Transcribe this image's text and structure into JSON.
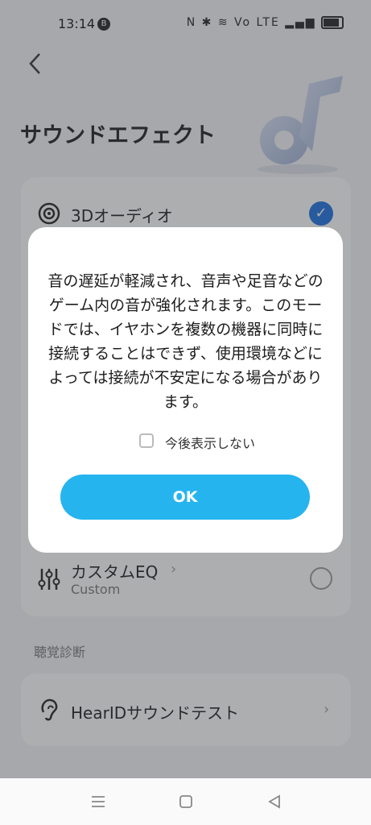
{
  "status_bar": {
    "time": "13:14",
    "badge": "B",
    "icons": "N ✱ ≋ Vo LTE ▂▄▆"
  },
  "header": {
    "back_icon": "chevron-left-icon",
    "title": "サウンドエフェクト"
  },
  "effects": {
    "item_3d": {
      "label": "3Dオーディオ",
      "selected": true
    },
    "item_custom": {
      "label": "カスタムEQ",
      "sublabel": "Custom",
      "selected": false
    }
  },
  "hearing": {
    "section_label": "聴覚診断",
    "test_label": "HearIDサウンドテスト"
  },
  "dialog": {
    "message": "音の遅延が軽減され、音声や足音などのゲーム内の音が強化されます。このモードでは、イヤホンを複数の機器に同時に接続することはできず、使用環境などによっては接続が不安定になる場合があります。",
    "checkbox_label": "今後表示しない",
    "ok_label": "OK"
  },
  "colors": {
    "accent_blue": "#26b4ef",
    "check_blue": "#1a6fe0"
  }
}
